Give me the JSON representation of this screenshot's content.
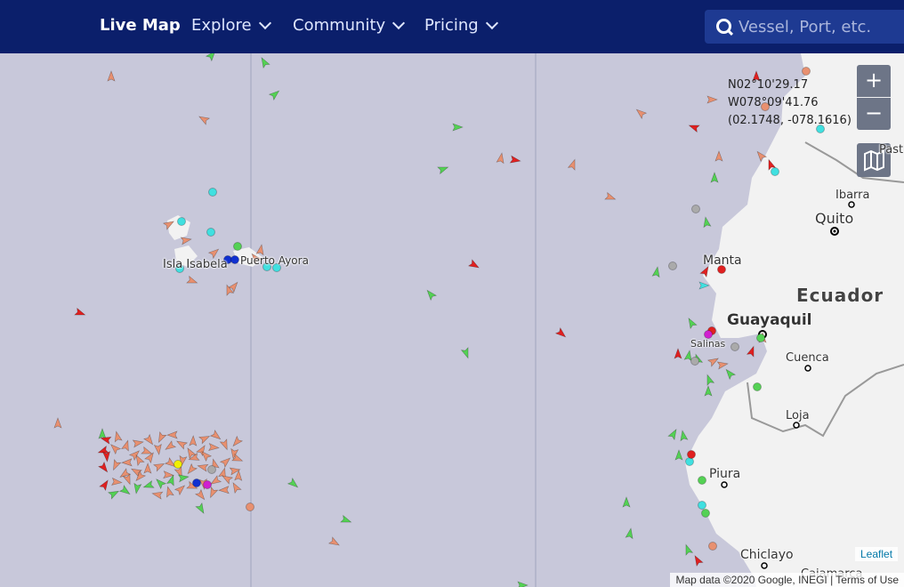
{
  "nav": {
    "live_map": "Live Map",
    "explore": "Explore",
    "community": "Community",
    "pricing": "Pricing",
    "search_placeholder": "Vessel, Port, etc."
  },
  "map": {
    "coords": {
      "line1": "N02°10'29.17",
      "line2": "W078°09'41.76",
      "line3": "(02.1748, -078.1616)"
    },
    "labels": {
      "isla_isabela": "Isla Isabela",
      "puerto_ayora": "Puerto Ayora",
      "manta": "Manta",
      "guayaquil": "Guayaquil",
      "salinas": "Salinas",
      "ecuador": "Ecuador",
      "quito": "Quito",
      "ibarra": "Ibarra",
      "pasto": "Past",
      "cuenca": "Cuenca",
      "loja": "Loja",
      "piura": "Piura",
      "chiclayo": "Chiclayo",
      "cajamarca": "Cajamarca"
    },
    "zoom_in": "+",
    "zoom_out": "−",
    "leaflet": "Leaflet",
    "attribution": "Map data ©2020 Google, INEGI | Terms of Use",
    "colors": {
      "ocean": "#c8c8da",
      "land": "#f2f2f2",
      "nav": "#0b1f6b",
      "cargo": "#54d154",
      "tanker": "#e02020",
      "fishing": "#e89070",
      "passenger": "#40e0e0"
    }
  }
}
